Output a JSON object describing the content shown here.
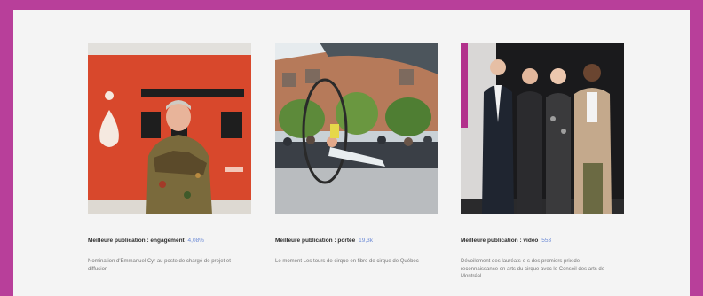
{
  "cards": [
    {
      "image": "portrait-man-destination-cirque-banner",
      "label": "Meilleure publication : engagement",
      "metric": "4,08%",
      "description": "Nomination d'Emmanuel Cyr au poste de chargé de projet et diffusion"
    },
    {
      "image": "performer-cyr-wheel-street",
      "label": "Meilleure publication : portée",
      "metric": "19,3k",
      "description": "Le moment Les tours de cirque en fibre de cirque de Québec"
    },
    {
      "image": "group-award-photo",
      "label": "Meilleure publication : vidéo",
      "metric": "553",
      "description": "Dévoilement des lauréats·e·s des premiers prix de reconnaissance en arts du cirque avec le Conseil des arts de Montréal"
    }
  ],
  "colors": {
    "frame": "#b83f9a",
    "panel": "#f4f4f4",
    "metric": "#6d8bd6"
  }
}
